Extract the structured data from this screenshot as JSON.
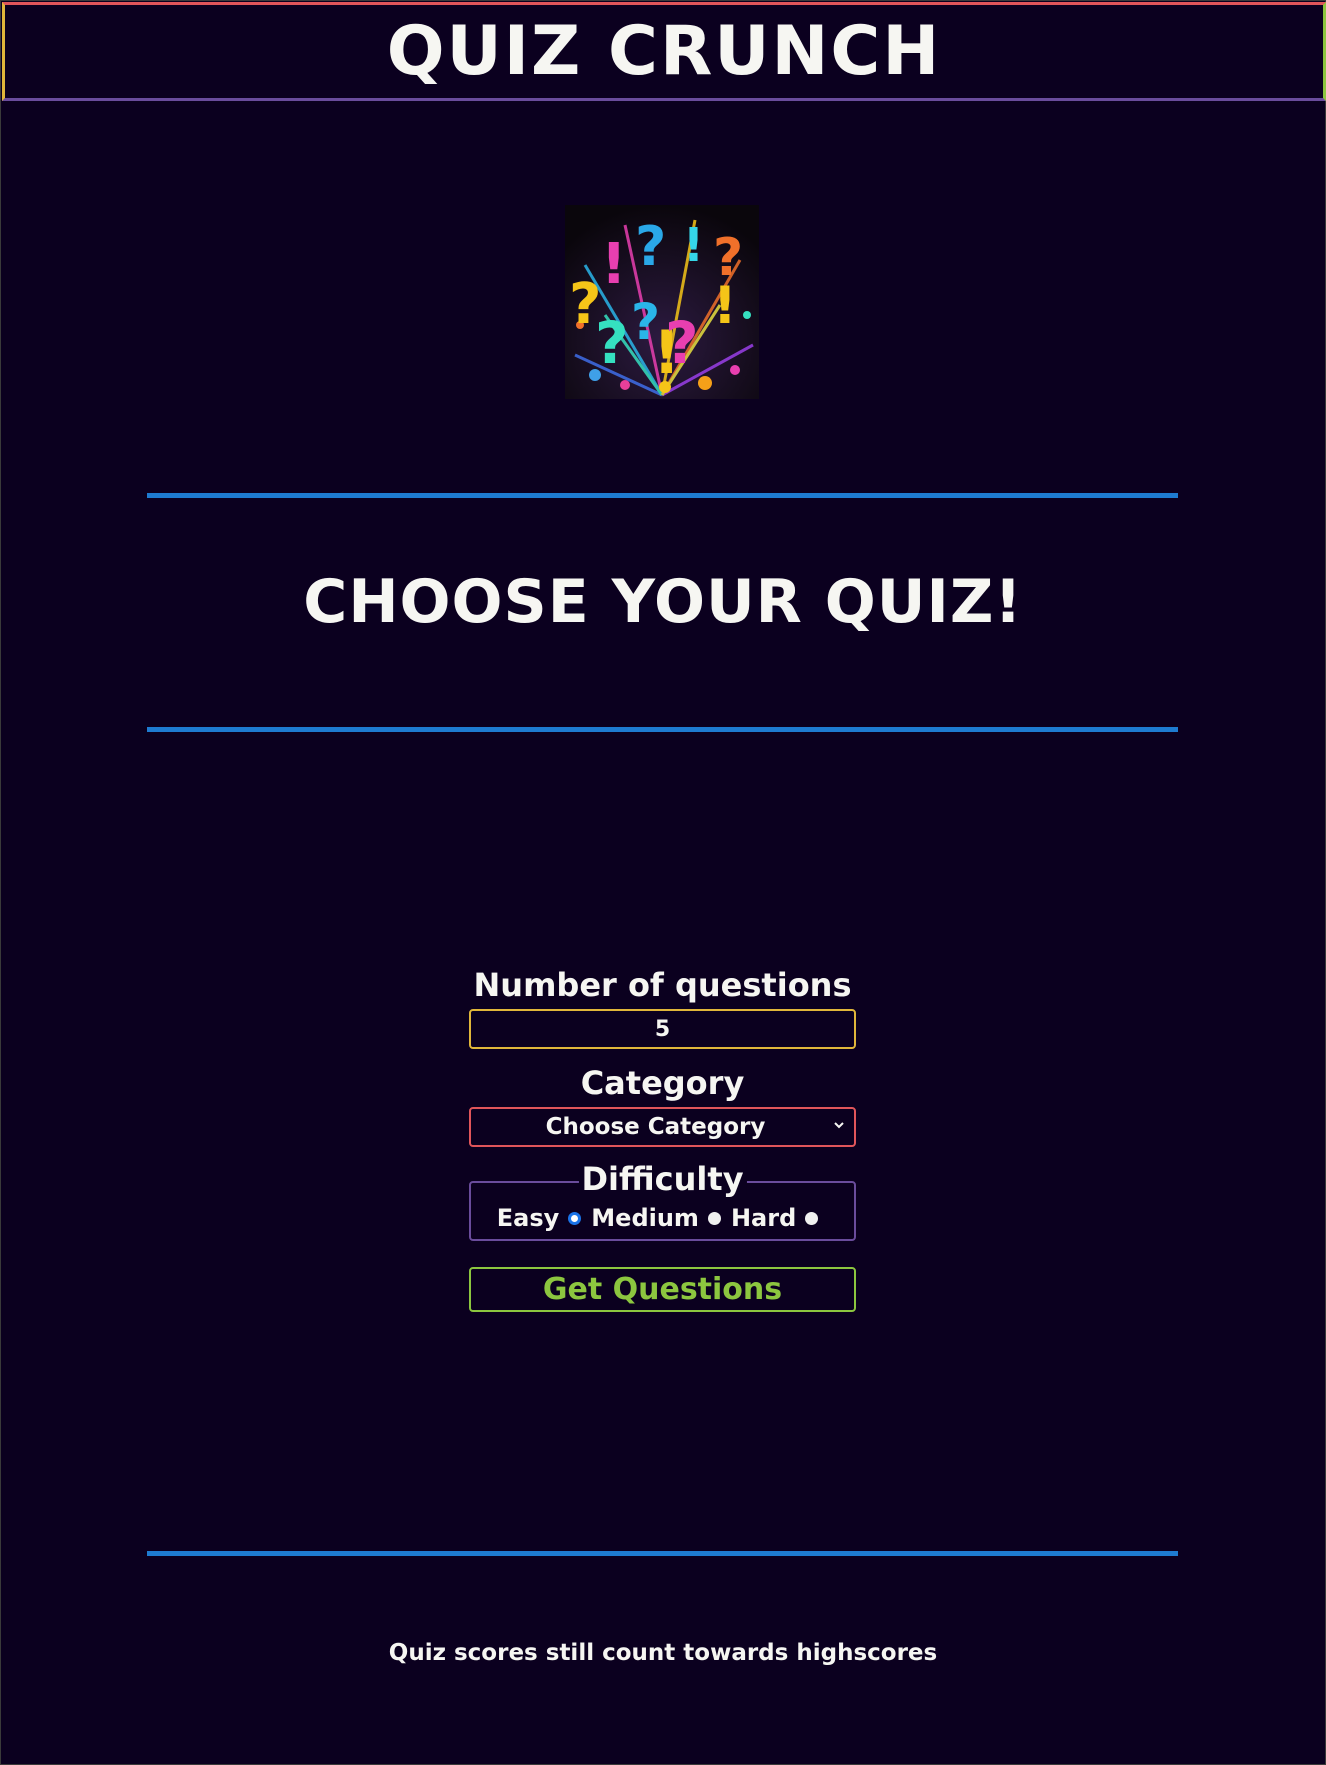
{
  "header": {
    "title": "QUIZ CRUNCH"
  },
  "logo": {
    "icon": "question-exclamation-paint-splash-icon"
  },
  "main": {
    "heading": "CHOOSE YOUR QUIZ!"
  },
  "form": {
    "num_questions": {
      "label": "Number of questions",
      "value": "5"
    },
    "category": {
      "label": "Category",
      "selected": "Choose Category"
    },
    "difficulty": {
      "legend": "Difficulty",
      "options": [
        "Easy",
        "Medium",
        "Hard"
      ],
      "selected": "Easy"
    },
    "submit_label": "Get Questions"
  },
  "footer": {
    "note": "Quiz scores still count towards highscores"
  },
  "colors": {
    "background": "#0b001f",
    "divider": "#1e7bd0",
    "accent_yellow": "#e0b63a",
    "accent_red": "#e0555a",
    "accent_purple": "#6a4c9c",
    "accent_green": "#8cc63f"
  }
}
